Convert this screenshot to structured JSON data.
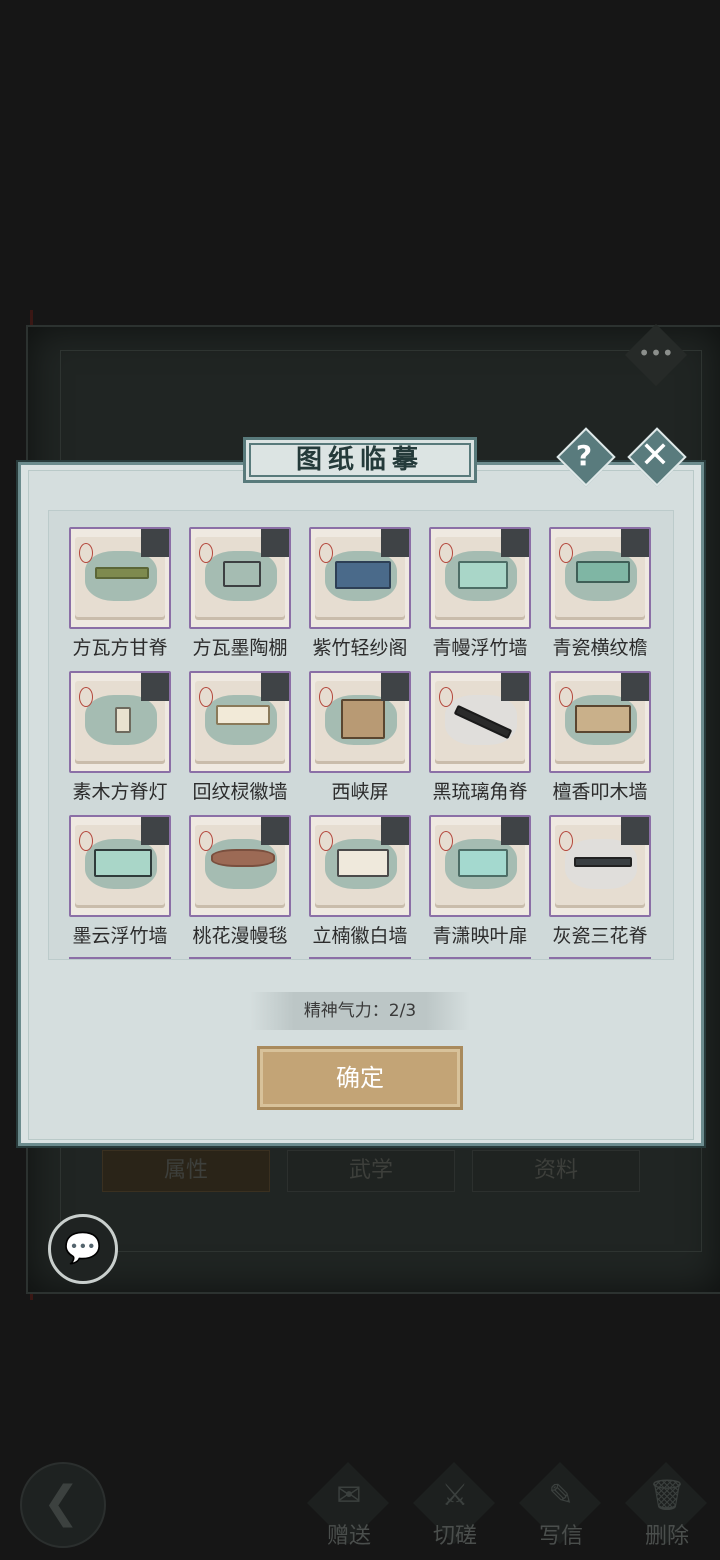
{
  "background": {
    "title": "",
    "tabs": [
      "属性",
      "武学",
      "资料"
    ],
    "more_icon": "more-dots-icon"
  },
  "dialog": {
    "title": "图纸临摹",
    "help_glyph": "?",
    "close_glyph": "✕",
    "items": [
      {
        "label": "方瓦方甘脊"
      },
      {
        "label": "方瓦墨陶棚"
      },
      {
        "label": "紫竹轻纱阁"
      },
      {
        "label": "青幔浮竹墙"
      },
      {
        "label": "青瓷横纹檐"
      },
      {
        "label": "素木方脊灯"
      },
      {
        "label": "回纹棂徽墙"
      },
      {
        "label": "西峡屏"
      },
      {
        "label": "黑琉璃角脊"
      },
      {
        "label": "檀香叩木墙"
      },
      {
        "label": "墨云浮竹墙"
      },
      {
        "label": "桃花漫幔毯"
      },
      {
        "label": "立楠徽白墙"
      },
      {
        "label": "青潇映叶扉"
      },
      {
        "label": "灰瓷三花脊"
      }
    ],
    "spirit_text": "精神气力：2/3",
    "confirm_label": "确定"
  },
  "chat": {
    "glyph": "💬"
  },
  "bottom_nav": {
    "back_glyph": "❮",
    "items": [
      {
        "label": "赠送",
        "icon": "gift-icon",
        "glyph": "✉"
      },
      {
        "label": "切磋",
        "icon": "sword-icon",
        "glyph": "⚔"
      },
      {
        "label": "写信",
        "icon": "letter-icon",
        "glyph": "✎"
      },
      {
        "label": "删除",
        "icon": "trash-icon",
        "glyph": "🗑"
      }
    ]
  },
  "colors": {
    "dialog_bg": "#dbe3e3",
    "frame": "#587a7b",
    "card_border": "#8b6fa6",
    "confirm": "#c3a476"
  }
}
